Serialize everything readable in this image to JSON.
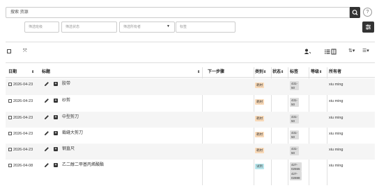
{
  "search": {
    "placeholder": "搜索 资源"
  },
  "filters": {
    "project": "筛选班级",
    "status": "筛选状态",
    "owner": "筛选所有者",
    "tags": "标签"
  },
  "help_label": "?",
  "columns": {
    "date": "日期",
    "title": "标题",
    "next_step": "下一步骤",
    "category": "类别",
    "status": "状态",
    "tags": "标签",
    "level": "等级",
    "owner": "所有者"
  },
  "rows": [
    {
      "date": "2026-04-23",
      "title": "胶带",
      "category": "耗材",
      "category_color": "#f8d9b8",
      "tags": [
        "431-50"
      ],
      "owner": "xiu ming"
    },
    {
      "date": "2026-04-23",
      "title": "纱剪",
      "category": "耗材",
      "category_color": "#f8d9b8",
      "tags": [
        "431-50"
      ],
      "owner": "xiu ming"
    },
    {
      "date": "2026-04-23",
      "title": "中型剪刀",
      "category": "耗材",
      "category_color": "#f8d9b8",
      "tags": [
        "431-50"
      ],
      "owner": "xiu ming"
    },
    {
      "date": "2026-04-23",
      "title": "裁缝大剪刀",
      "category": "耗材",
      "category_color": "#f8d9b8",
      "tags": [
        "431-50"
      ],
      "owner": "xiu ming"
    },
    {
      "date": "2026-04-23",
      "title": "钢直尺",
      "category": "耗材",
      "category_color": "#f8d9b8",
      "tags": [
        "431-50"
      ],
      "owner": "xiu ming"
    },
    {
      "date": "2026-04-08",
      "title": "乙二醇二甲基丙烯酸酯",
      "category": "试剂",
      "category_color": "#b8e6ec",
      "tags": [
        "427-02555",
        "427-02888"
      ],
      "owner": "xiu ming"
    }
  ]
}
